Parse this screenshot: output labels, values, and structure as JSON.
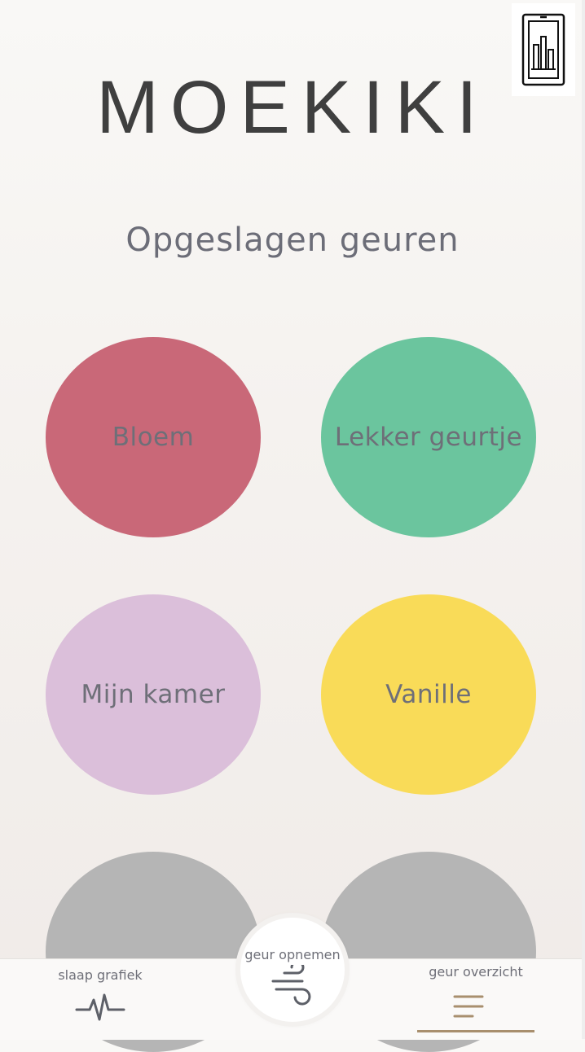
{
  "app": {
    "title": "MOEKIKI"
  },
  "header": {
    "stats_icon": "phone-chart-icon"
  },
  "main": {
    "title": "Opgeslagen geuren",
    "scents": [
      {
        "label": "Bloem",
        "color": "#c96878"
      },
      {
        "label": "Lekker geurtje",
        "color": "#6bc59e"
      },
      {
        "label": "Mijn kamer",
        "color": "#dbbfda"
      },
      {
        "label": "Vanille",
        "color": "#f9db58"
      },
      {
        "label": "",
        "color": "#b5b5b5"
      },
      {
        "label": "",
        "color": "#b5b5b5"
      }
    ]
  },
  "nav": {
    "left": {
      "label": "slaap grafiek",
      "icon": "heartbeat-icon"
    },
    "center": {
      "label": "geur opnemen",
      "icon": "wind-icon"
    },
    "right": {
      "label": "geur overzicht",
      "icon": "menu-icon",
      "active": true
    }
  },
  "colors": {
    "text": "#6e6f78",
    "logo": "#3f3f3f",
    "accent": "#a88f6e",
    "icon": "#5d6068"
  }
}
